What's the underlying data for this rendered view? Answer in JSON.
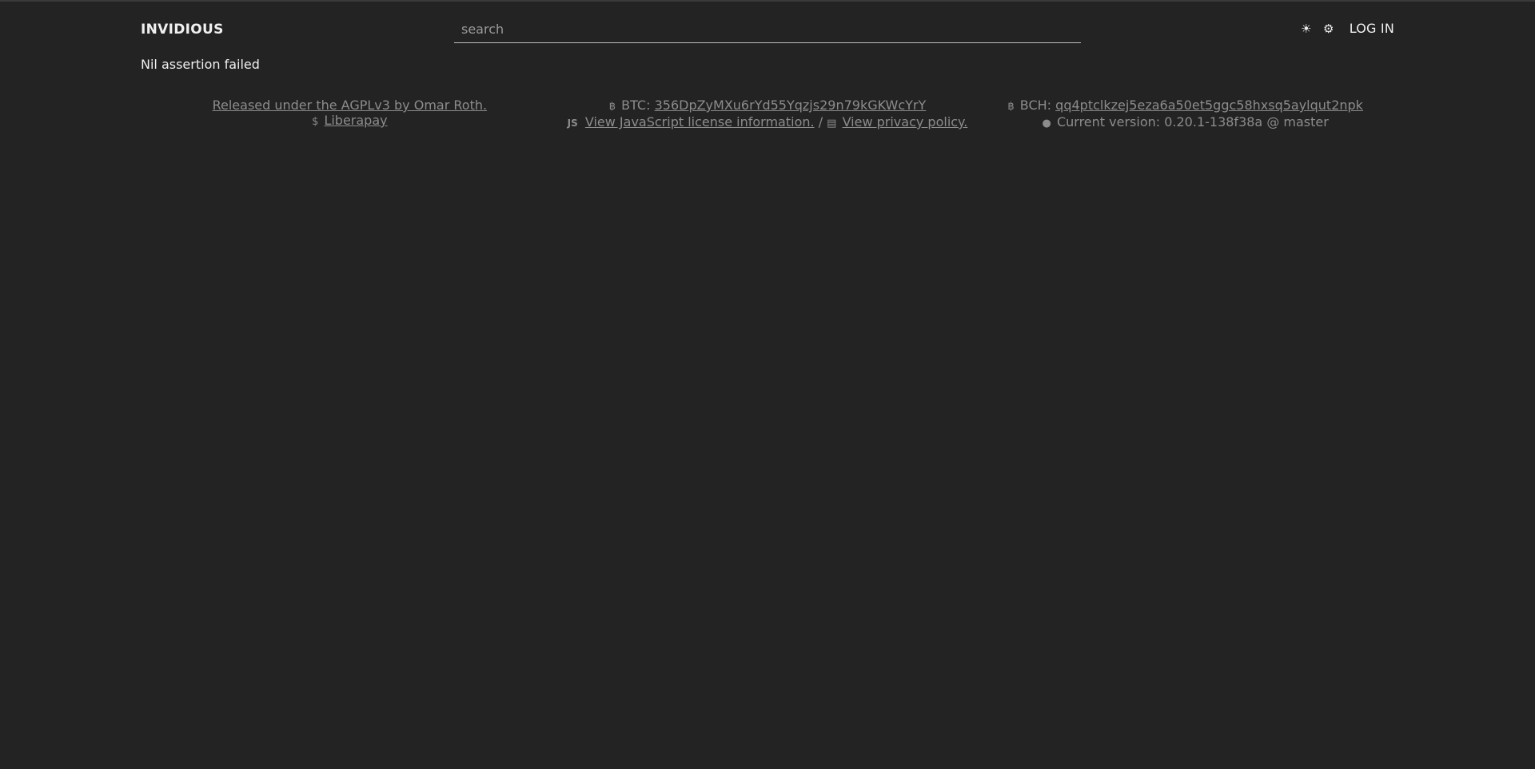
{
  "navbar": {
    "brand": "INVIDIOUS",
    "search_placeholder": "search",
    "theme_icon": "☀",
    "preferences_icon": "⚙",
    "login_label": "LOG IN"
  },
  "error": {
    "message": "Nil assertion failed"
  },
  "footer": {
    "col1": {
      "license_text": "Released under the AGPLv3 by Omar Roth.",
      "donate_icon": "$",
      "liberapay_label": "Liberapay"
    },
    "col2": {
      "btc_icon": "฿",
      "btc_prefix": "BTC:",
      "btc_address": "356DpZyMXu6rYd55Yqzjs29n79kGKWcYrY",
      "js_icon": "JS",
      "js_license_label": "View JavaScript license information.",
      "separator": "/",
      "privacy_icon": "▤",
      "privacy_label": "View privacy policy."
    },
    "col3": {
      "bch_icon": "฿",
      "bch_prefix": "BCH:",
      "bch_address": "qq4ptclkzej5eza6a50et5ggc58hxsq5aylqut2npk",
      "github_icon": "●",
      "version_text": "Current version: 0.20.1-138f38a @ master"
    }
  },
  "colors": {
    "background": "#232323",
    "text": "#f0f0f0",
    "muted": "#8c8c8c"
  }
}
